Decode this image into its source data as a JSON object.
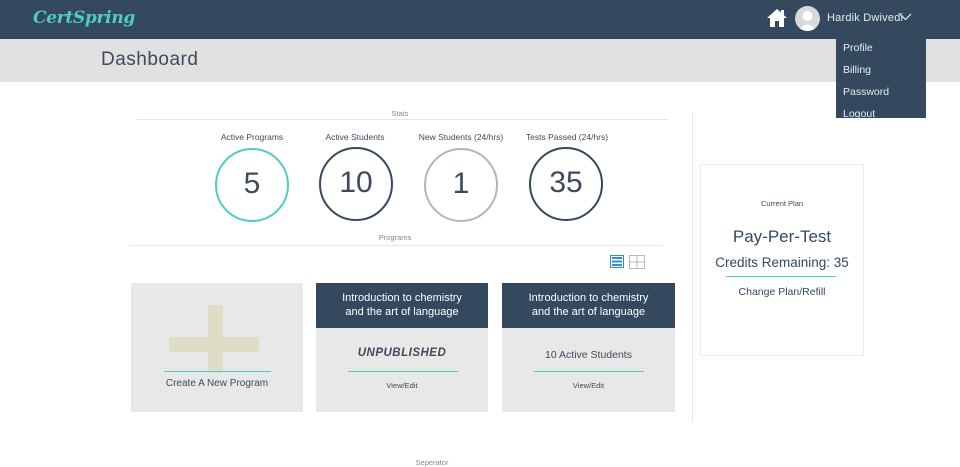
{
  "header": {
    "logo": "CertSpring",
    "user_name": "Hardik Dwivedi",
    "menu": [
      "Profile",
      "Billing",
      "Password",
      "Logout"
    ]
  },
  "page": {
    "title": "Dashboard"
  },
  "stats": {
    "section_label": "Stats",
    "items": [
      {
        "label": "Active Programs",
        "value": "5",
        "color": "#4ecdc4"
      },
      {
        "label": "Active Students",
        "value": "10",
        "color": "#34495e"
      },
      {
        "label": "New Students (24/hrs)",
        "value": "1",
        "color": "#b5b5b5"
      },
      {
        "label": "Tests Passed (24/hrs)",
        "value": "35",
        "color": "#34495e"
      }
    ]
  },
  "programs": {
    "section_label": "Programs",
    "create_label": "Create A New Program",
    "cards": [
      {
        "title_line1": "Introduction to chemistry",
        "title_line2": "and the art of language",
        "status": "UNPUBLISHED",
        "link": "View/Edit"
      },
      {
        "title_line1": "Introduction to chemistry",
        "title_line2": "and the art of language",
        "status": "10 Active Students",
        "link": "View/Edit"
      }
    ]
  },
  "plan": {
    "caption": "Current Plan",
    "name": "Pay-Per-Test",
    "credits": "Credits Remaining: 35",
    "change_link": "Change Plan/Refill"
  },
  "footer": {
    "separator_label": "Seperator"
  },
  "colors": {
    "navy": "#34495e",
    "teal": "#4ecdc4",
    "gray_bg": "#e1e1e1"
  },
  "icons": [
    "home-icon",
    "avatar-icon",
    "chevron-down-icon",
    "list-view-icon",
    "grid-view-icon",
    "plus-icon"
  ]
}
